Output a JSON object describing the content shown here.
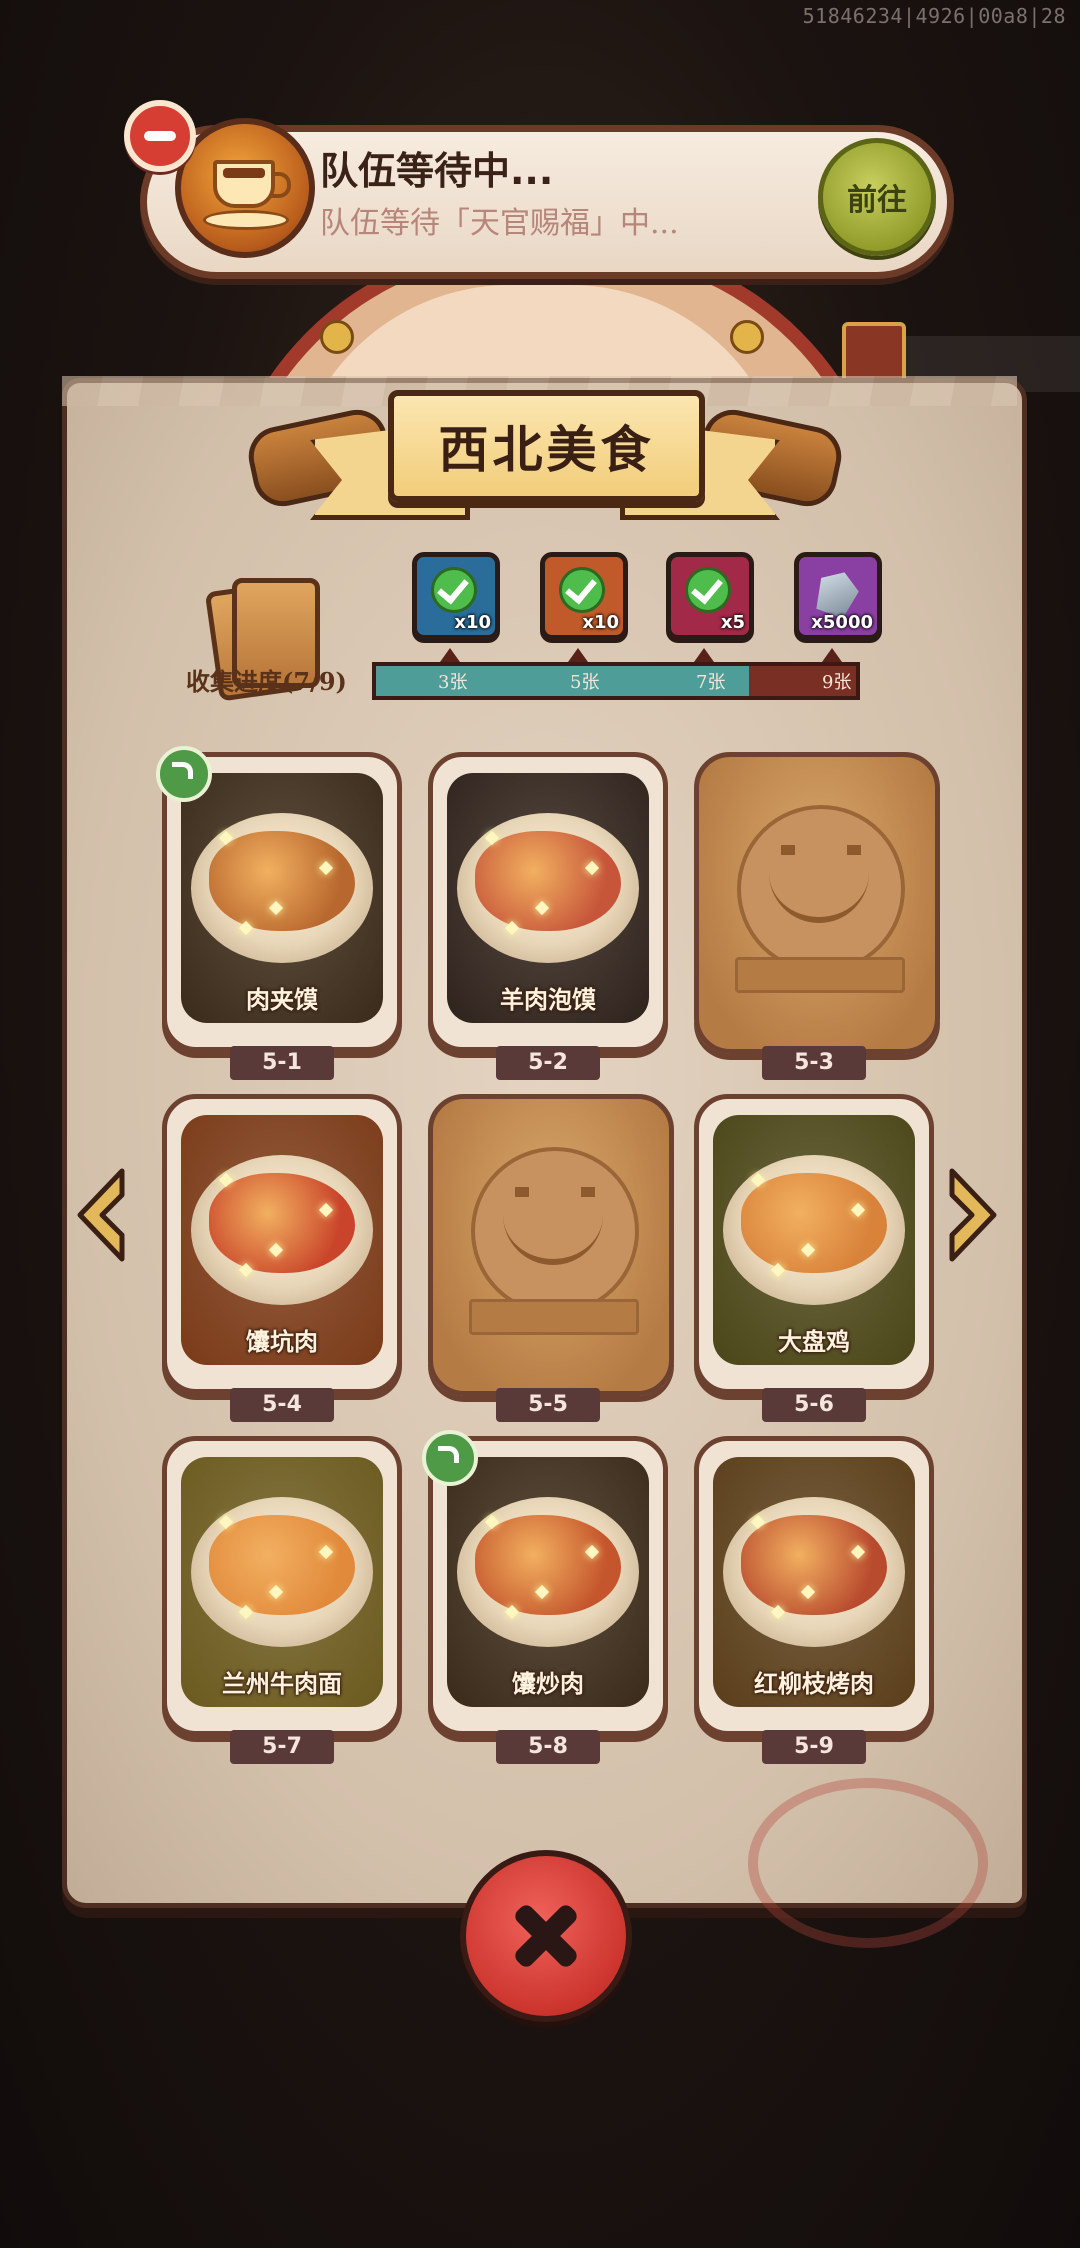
{
  "debug_id": "51846234|4926|00a8|28",
  "team_banner": {
    "title": "队伍等待中...",
    "subtitle": "队伍等待「天官赐福」中...",
    "goto_label": "前往"
  },
  "panel": {
    "title": "西北美食",
    "progress_label": "收集进度(7/9)",
    "progress": {
      "collected": 7,
      "total": 9
    },
    "rewards": [
      {
        "icon": "chest-icon",
        "qty": "x10",
        "threshold": "3张",
        "color": "#2a6d9a"
      },
      {
        "icon": "scroll-icon",
        "qty": "x10",
        "threshold": "5张",
        "color": "#c05a2a"
      },
      {
        "icon": "potion-orb-icon",
        "qty": "x5",
        "threshold": "7张",
        "color": "#a22a48"
      },
      {
        "icon": "crystal-icon",
        "qty": "x5000",
        "threshold": "9张",
        "color": "#8a3fa3"
      }
    ]
  },
  "foods": [
    {
      "tag": "5-1",
      "name": "肉夹馍",
      "unlocked": true,
      "share": true,
      "dish_color": "#b8682e",
      "bg": "#3a2a1a"
    },
    {
      "tag": "5-2",
      "name": "羊肉泡馍",
      "unlocked": true,
      "share": false,
      "dish_color": "#c6553a",
      "bg": "#2e221c"
    },
    {
      "tag": "5-3",
      "name": "",
      "unlocked": false,
      "share": false
    },
    {
      "tag": "5-4",
      "name": "馕坑肉",
      "unlocked": true,
      "share": false,
      "dish_color": "#c9442a",
      "bg": "#7a3a18"
    },
    {
      "tag": "5-5",
      "name": "",
      "unlocked": false,
      "share": false
    },
    {
      "tag": "5-6",
      "name": "大盘鸡",
      "unlocked": true,
      "share": false,
      "dish_color": "#d8823a",
      "bg": "#4a4618"
    },
    {
      "tag": "5-7",
      "name": "兰州牛肉面",
      "unlocked": true,
      "share": false,
      "dish_color": "#e28a3c",
      "bg": "#6a5a1e"
    },
    {
      "tag": "5-8",
      "name": "馕炒肉",
      "unlocked": true,
      "share": true,
      "dish_color": "#c4552c",
      "bg": "#3a2a1a"
    },
    {
      "tag": "5-9",
      "name": "红柳枝烤肉",
      "unlocked": true,
      "share": false,
      "dish_color": "#b84a2e",
      "bg": "#5a3e1a"
    }
  ]
}
